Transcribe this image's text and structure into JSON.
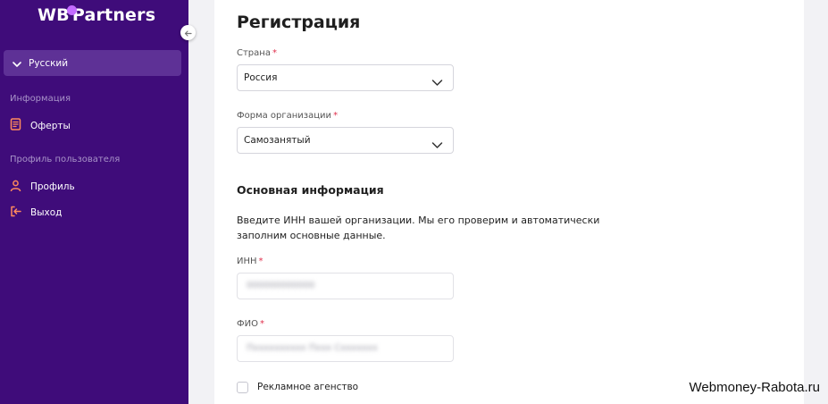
{
  "sidebar": {
    "logo": {
      "left": "WB",
      "right": "Partners"
    },
    "language": {
      "label": "Русский"
    },
    "sections": [
      {
        "title": "Информация",
        "items": [
          {
            "label": "Оферты",
            "icon": "document-icon"
          }
        ]
      },
      {
        "title": "Профиль пользователя",
        "items": [
          {
            "label": "Профиль",
            "icon": "user-icon"
          },
          {
            "label": "Выход",
            "icon": "logout-icon"
          }
        ]
      }
    ]
  },
  "form": {
    "title": "Регистрация",
    "country": {
      "label": "Страна",
      "required": "*",
      "value": "Россия"
    },
    "org_form": {
      "label": "Форма организации",
      "required": "*",
      "value": "Самозанятый"
    },
    "section_heading": "Основная информация",
    "helper_text": "Введите ИНН вашей организации. Мы его проверим и автоматически заполним основные данные.",
    "inn": {
      "label": "ИНН",
      "required": "*",
      "value": "000000000000"
    },
    "fio": {
      "label": "ФИО",
      "required": "*",
      "value": "Пxxxxxxxxxx Пxxx Сxxxxxxx"
    },
    "ad_agency": {
      "label": "Рекламное агенство",
      "checked": false
    }
  },
  "watermark": "Webmoney-Rabota.ru",
  "colors": {
    "sidebar_bg": "#3f0c7a",
    "sidebar_active": "#5e3196",
    "accent_icon": "#ff8a5c",
    "required": "#e0304d"
  }
}
